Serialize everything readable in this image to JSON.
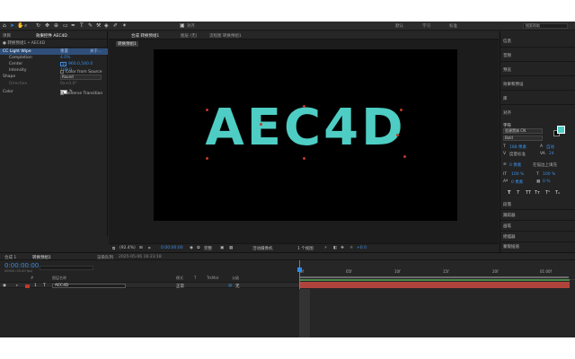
{
  "toolbar": {
    "workspace_labels": [
      "默认",
      "学习",
      "标准"
    ],
    "search_placeholder": "搜索帮助"
  },
  "left_panel": {
    "tabs": [
      "项目",
      "效果控件 AEC4D"
    ],
    "extra_tab": "音频",
    "breadcrumb": "● 转换预组1 • AEC4D",
    "effect_name": "CC Light Wipe",
    "effect_reset": "重置",
    "effect_about": "关于...",
    "props": [
      {
        "name": "Completion",
        "value": "4.0%"
      },
      {
        "name": "Center",
        "value": "960.0,540.0"
      },
      {
        "name": "Intensity",
        "value": "100.0"
      },
      {
        "name": "Shape",
        "value": "Round"
      },
      {
        "name": "Direction",
        "value": "0x+0.0°"
      },
      {
        "name": "Color",
        "value": ""
      },
      {
        "name": "Color from Source",
        "value": ""
      },
      {
        "name": "Reverse Transition",
        "value": ""
      }
    ]
  },
  "comp_panel": {
    "tabs": [
      "合成 转换预组1",
      "图层 (无)",
      "流程图 转换预组1"
    ],
    "menu_icon": "≡",
    "crumb": "转换预组1",
    "canvas_text": "AEC4D",
    "footer": {
      "zoom": "(92.4%)",
      "timecode": "0:00:00:00",
      "quality": "完整",
      "camera": "活动摄像机",
      "views": "1 个视图",
      "exposure": "+0.0"
    }
  },
  "right_panel": {
    "items_top": [
      "信息",
      "音频",
      "预览",
      "效果和预设",
      "库",
      "对齐"
    ],
    "char_header": "字符",
    "font_name": "思源黑体 CN",
    "font_style": "Bold",
    "font_size": "188 像素",
    "leading": "自动",
    "kerning": "度量标准",
    "tracking": "24",
    "stroke": "0 像素",
    "stroke_type": "在描边上填充",
    "vscale": "100 %",
    "hscale": "100 %",
    "baseline": "0 像素",
    "tsume": "0 %",
    "styles": [
      "T",
      "T",
      "TT",
      "Tт",
      "T¹",
      "T₁"
    ],
    "items_bottom": [
      "段落",
      "跟踪器",
      "画笔",
      "摇摆器",
      "蒙版插值",
      "平滑器"
    ]
  },
  "timeline": {
    "tabs": [
      "合成 1",
      "转换预组1",
      "渲染队列"
    ],
    "render_tab_note": "2025-05-06 16:23:18",
    "timecode": "0:00:00:00",
    "sub_timecode": "00000 (25.00 fps)",
    "columns": [
      "#",
      "图层名称",
      "模式",
      "T",
      "TrkMat",
      "父级"
    ],
    "layer": {
      "index": "1",
      "name": "AEC4D",
      "mode": "正常",
      "parent": "无"
    },
    "ticks": [
      "0f",
      "05f",
      "10f",
      "15f",
      "20f",
      "01:00f"
    ]
  },
  "colors": {
    "accent": "#2d8ceb",
    "canvas_text": "#4ecdc4",
    "layer_bar": "#b0443c",
    "label_red": "#c0392b"
  }
}
